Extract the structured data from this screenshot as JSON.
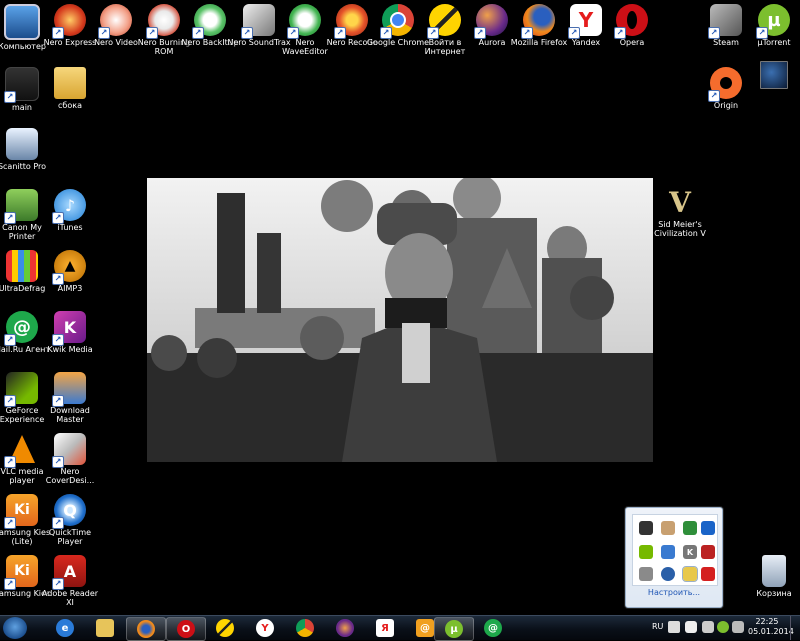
{
  "desktop": {
    "icons": {
      "computer": "Компьютер",
      "nero_express": "Nero Express",
      "nero_video": "Nero Video",
      "nero_burning_rom": "Nero Burning ROM",
      "nero_backitup": "Nero BackItUp",
      "nero_soundtrax": "Nero SoundTrax",
      "nero_waveeditor": "Nero WaveEditor",
      "nero_recode": "Nero Recode",
      "google_chrome": "Google Chrome",
      "login_internet": "Войти в Интернет",
      "aurora": "Aurora",
      "mozilla_firefox": "Mozilla Firefox",
      "yandex": "Yandex",
      "opera": "Opera",
      "steam": "Steam",
      "utorrent": "µTorrent",
      "main": "main",
      "sborka": "сбока",
      "origin": "Origin",
      "scanitto": "Scanitto Pro",
      "canon": "Canon My Printer",
      "itunes": "iTunes",
      "civ5": "Sid Meier's Civilization V",
      "ultradefrag": "UltraDefrag",
      "aimp3": "AIMP3",
      "mailru": "Mail.Ru Агент",
      "kwik": "Kwik Media",
      "geforce": "GeForce Experience",
      "download_master": "Download Master",
      "vlc": "VLC media player",
      "nero_coverdesigner": "Nero CoverDesi...",
      "samsung_kies_lite": "Samsung Kies (Lite)",
      "quicktime": "QuickTime Player",
      "samsung_kies": "Samsung Kies",
      "adobe_reader": "Adobe Reader XI",
      "recycle_bin": "Корзина"
    }
  },
  "tray_popup": {
    "customize_label": "Настроить..."
  },
  "taskbar": {
    "language": "RU",
    "time": "22:25",
    "date": "05.01.2014"
  }
}
